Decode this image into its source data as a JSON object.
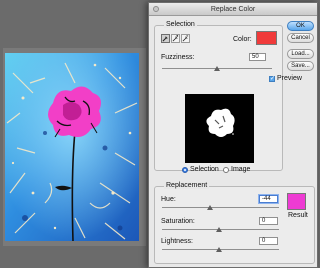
{
  "window": {
    "title": "Replace Color"
  },
  "selection_group": {
    "title": "Selection",
    "color_label": "Color:",
    "color_swatch": "#f03a3a",
    "fuzziness_label": "Fuzziness:",
    "fuzziness_value": "50",
    "fuzziness_level": 0.5,
    "view_options": [
      "Selection",
      "Image"
    ],
    "selected_view": "Selection"
  },
  "replacement_group": {
    "title": "Replacement",
    "hue_label": "Hue:",
    "hue_value": "-44",
    "saturation_label": "Saturation:",
    "saturation_value": "0",
    "lightness_label": "Lightness:",
    "lightness_value": "0",
    "result_label": "Result",
    "result_swatch": "#ee3bd3"
  },
  "buttons": {
    "ok": "OK",
    "cancel": "Cancel",
    "load": "Load...",
    "save": "Save..."
  },
  "preview": {
    "label": "Preview",
    "checked": true
  },
  "colors": {
    "flower": "#f23fc7",
    "sky_light": "#58c8ef",
    "sky_dark": "#1f5fbf"
  }
}
